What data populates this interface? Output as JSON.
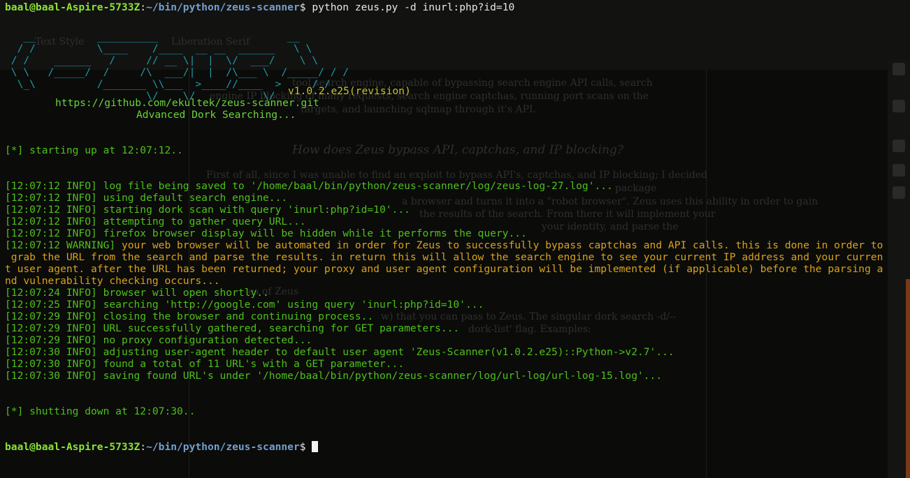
{
  "prompt": {
    "user_host": "baal@baal-Aspire-5733Z",
    "sep": ":",
    "cwd": "~/bin/python/zeus-scanner",
    "dollar": "$",
    "command": " python zeus.py -d inurl:php?id=10"
  },
  "banner": {
    "logo_lines": [
      "   __          __________                     __",
      "  / /          \\____    /____  __ __  ______   \\ \\",
      " / /    ______   /     // __ \\|  |  \\/  ___/    \\ \\",
      " \\ \\   /_____/  /     /\\  ___/|  |  /\\___ \\  /_____/ / /",
      "  \\_\\          /_______ \\\\___  >____//____  >     /_/",
      "                       \\/    \\/           \\/"
    ],
    "version": "v1.0.2.e25",
    "version_paren_open": "(",
    "revision": "revision",
    "version_paren_close": ")",
    "url": "https://github.com/ekultek/zeus-scanner.git",
    "tagline": "Advanced Dork Searching..."
  },
  "log": {
    "startup": "[*] starting up at 12:07:12..",
    "entries": [
      {
        "tag": "[12:07:12 INFO]",
        "msg": " log file being saved to '/home/baal/bin/python/zeus-scanner/log/zeus-log-27.log'...",
        "level": "info"
      },
      {
        "tag": "[12:07:12 INFO]",
        "msg": " using default search engine...",
        "level": "info"
      },
      {
        "tag": "[12:07:12 INFO]",
        "msg": " starting dork scan with query 'inurl:php?id=10'...",
        "level": "info"
      },
      {
        "tag": "[12:07:12 INFO]",
        "msg": " attempting to gather query URL...",
        "level": "info"
      },
      {
        "tag": "[12:07:12 INFO]",
        "msg": " firefox browser display will be hidden while it performs the query...",
        "level": "info"
      }
    ],
    "warning": {
      "tag": "[12:07:12 WARNING]",
      "lines": [
        " your web browser will be automated in order for Zeus to successfully bypass captchas and API calls. this is done in order to",
        " grab the URL from the search and parse the results. in return this will allow the search engine to see your current IP address and your curren",
        "t user agent. after the URL has been returned; your proxy and user agent configuration will be implemented (if applicable) before the parsing a",
        "nd vulnerability checking occurs..."
      ]
    },
    "entries2": [
      {
        "tag": "[12:07:24 INFO]",
        "msg": " browser will open shortly.."
      },
      {
        "tag": "[12:07:25 INFO]",
        "msg": " searching 'http://google.com' using query 'inurl:php?id=10'..."
      },
      {
        "tag": "[12:07:29 INFO]",
        "msg": " closing the browser and continuing process.."
      },
      {
        "tag": "[12:07:29 INFO]",
        "msg": " URL successfully gathered, searching for GET parameters..."
      },
      {
        "tag": "[12:07:29 INFO]",
        "msg": " no proxy configuration detected..."
      },
      {
        "tag": "[12:07:30 INFO]",
        "msg": " adjusting user-agent header to default user agent 'Zeus-Scanner(v1.0.2.e25)::Python->v2.7'..."
      },
      {
        "tag": "[12:07:30 INFO]",
        "msg": " found a total of 11 URL's with a GET parameter..."
      },
      {
        "tag": "[12:07:30 INFO]",
        "msg": " saving found URL's under '/home/baal/bin/python/zeus-scanner/log/url-log/url-log-15.log'..."
      }
    ],
    "shutdown": "[*] shutting down at 12:07:30.."
  },
  "background_doc": {
    "toolbar_left": "Text Style",
    "toolbar_font": "Liberation Serif",
    "p1a": "tool search engine,  capable of bypassing search engine API calls, search",
    "p1b": "engine IP blocking of many requests, search engine captchas, running port scans on the",
    "p1c": "targets, and launching sqlmap through it's API.",
    "heading": "How does Zeus bypass API, captchas, and IP blocking?",
    "p2a": "First of all, since I was unable to find an exploit to bypass API's, captchas, and IP blocking; I decided",
    "p2b": "package",
    "p2c": "a browser and turns it into a \"robot browser\". Zeus uses this ability in order to gain",
    "p2d": "the results of the search. From there it will implement your",
    "p2e": "your identity, and parse the",
    "p3a": "es of Zeus",
    "p3b": "w) that you can pass to Zeus. The singular dork search -d/--",
    "p3c": "dork-list' flag. Examples:"
  },
  "colors": {
    "info": "#4ec01a",
    "warning": "#d9a21a",
    "prompt_user": "#8ae234",
    "prompt_path": "#729fcf",
    "logo": "#1f9aa7"
  }
}
